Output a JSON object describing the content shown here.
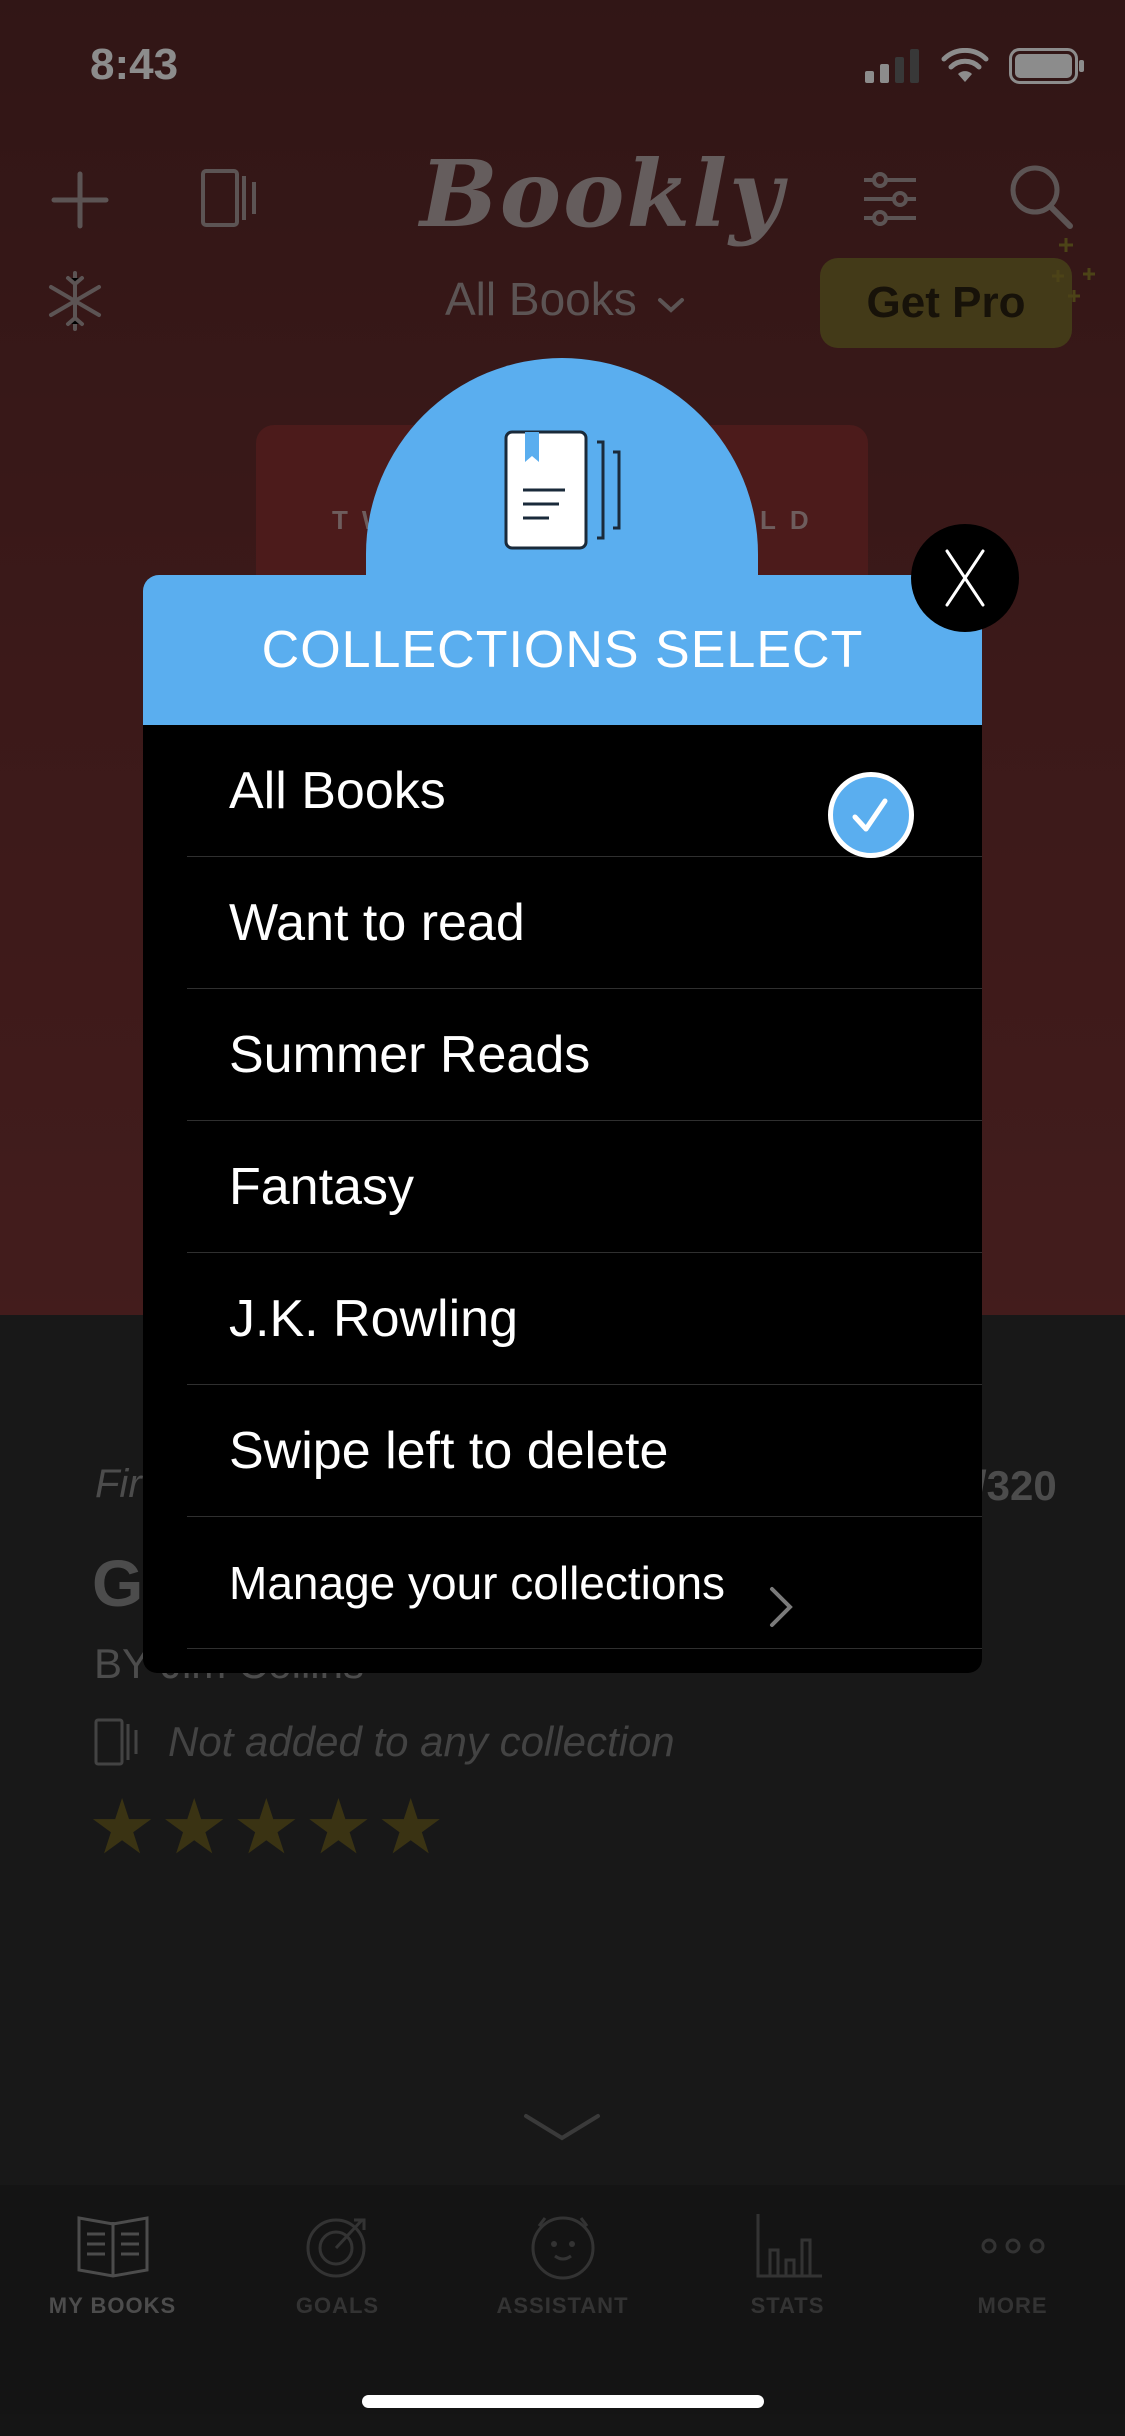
{
  "status": {
    "time": "8:43"
  },
  "app": {
    "logo": "Bookly",
    "collection_dropdown": "All Books",
    "get_pro": "Get Pro"
  },
  "book": {
    "cover_text_left": "TW",
    "cover_text_right": "LD",
    "first_label": "Fir",
    "page_count": "/320",
    "title": "G",
    "author": "BY Jim Collins",
    "collection_status": "Not added to any collection",
    "rating_stars": 5
  },
  "modal": {
    "title": "COLLECTIONS SELECT",
    "items": [
      {
        "label": "All Books",
        "selected": true
      },
      {
        "label": "Want to read",
        "selected": false
      },
      {
        "label": "Summer Reads",
        "selected": false
      },
      {
        "label": "Fantasy",
        "selected": false
      },
      {
        "label": "J.K. Rowling",
        "selected": false
      },
      {
        "label": "Swipe left to delete",
        "selected": false
      }
    ],
    "manage_label": "Manage your collections",
    "close_label": "X"
  },
  "tabs": [
    {
      "label": "MY BOOKS",
      "icon": "open-book-icon",
      "active": true
    },
    {
      "label": "GOALS",
      "icon": "target-icon",
      "active": false
    },
    {
      "label": "ASSISTANT",
      "icon": "assistant-icon",
      "active": false
    },
    {
      "label": "STATS",
      "icon": "bar-chart-icon",
      "active": false
    },
    {
      "label": "MORE",
      "icon": "more-dots-icon",
      "active": false
    }
  ],
  "colors": {
    "accent": "#5aaeef",
    "pro_button": "#7a6a2c",
    "background_top": "#6b2e2e"
  }
}
